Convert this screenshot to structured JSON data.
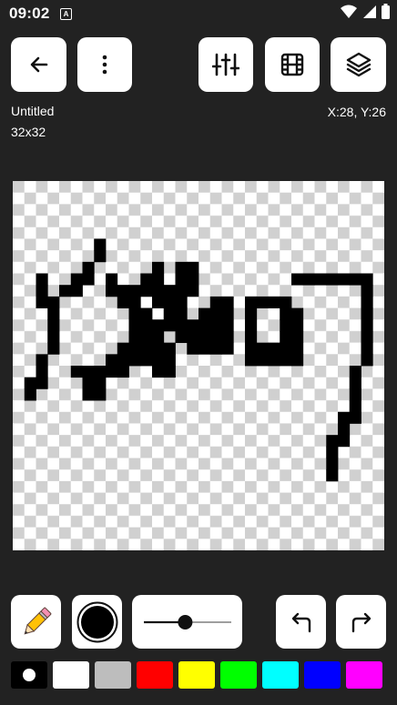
{
  "status_bar": {
    "time": "09:02",
    "app_indicator": "A",
    "icons": [
      "wifi-icon",
      "signal-icon",
      "battery-icon"
    ]
  },
  "toolbar": {
    "back_icon": "arrow-left-icon",
    "menu_icon": "more-vertical-icon",
    "adjust_icon": "sliders-icon",
    "frames_icon": "film-icon",
    "layers_icon": "layers-icon"
  },
  "document": {
    "name": "Untitled",
    "size": "32x32",
    "cursor": "X:28, Y:26"
  },
  "canvas": {
    "grid_cols": 32,
    "grid_rows": 32,
    "pixel_color": "#000000",
    "pixels": [
      [
        7,
        5
      ],
      [
        7,
        6
      ],
      [
        6,
        7
      ],
      [
        12,
        7
      ],
      [
        5,
        8
      ],
      [
        6,
        8
      ],
      [
        11,
        8
      ],
      [
        12,
        8
      ],
      [
        2,
        8
      ],
      [
        2,
        9
      ],
      [
        2,
        10
      ],
      [
        4,
        9
      ],
      [
        5,
        9
      ],
      [
        3,
        10
      ],
      [
        8,
        8
      ],
      [
        8,
        9
      ],
      [
        9,
        9
      ],
      [
        9,
        10
      ],
      [
        10,
        10
      ],
      [
        10,
        9
      ],
      [
        11,
        9
      ],
      [
        24,
        8
      ],
      [
        25,
        8
      ],
      [
        26,
        8
      ],
      [
        27,
        8
      ],
      [
        28,
        8
      ],
      [
        29,
        8
      ],
      [
        30,
        8
      ],
      [
        30,
        9
      ],
      [
        30,
        10
      ],
      [
        30,
        11
      ],
      [
        30,
        12
      ],
      [
        30,
        13
      ],
      [
        30,
        14
      ],
      [
        30,
        15
      ],
      [
        20,
        10
      ],
      [
        21,
        10
      ],
      [
        22,
        10
      ],
      [
        23,
        10
      ],
      [
        20,
        11
      ],
      [
        23,
        11
      ],
      [
        20,
        12
      ],
      [
        23,
        12
      ],
      [
        20,
        13
      ],
      [
        23,
        13
      ],
      [
        20,
        14
      ],
      [
        21,
        14
      ],
      [
        22,
        14
      ],
      [
        23,
        14
      ],
      [
        24,
        14
      ],
      [
        24,
        13
      ],
      [
        24,
        12
      ],
      [
        24,
        11
      ],
      [
        20,
        15
      ],
      [
        21,
        15
      ],
      [
        22,
        15
      ],
      [
        23,
        15
      ],
      [
        24,
        15
      ],
      [
        17,
        10
      ],
      [
        18,
        10
      ],
      [
        18,
        11
      ],
      [
        16,
        11
      ],
      [
        17,
        11
      ],
      [
        18,
        12
      ],
      [
        14,
        12
      ],
      [
        15,
        12
      ],
      [
        16,
        12
      ],
      [
        17,
        12
      ],
      [
        14,
        13
      ],
      [
        15,
        13
      ],
      [
        16,
        13
      ],
      [
        17,
        13
      ],
      [
        10,
        11
      ],
      [
        10,
        12
      ],
      [
        11,
        11
      ],
      [
        11,
        12
      ],
      [
        11,
        13
      ],
      [
        11,
        14
      ],
      [
        10,
        13
      ],
      [
        12,
        13
      ],
      [
        12,
        14
      ],
      [
        12,
        15
      ],
      [
        13,
        14
      ],
      [
        13,
        15
      ],
      [
        13,
        16
      ],
      [
        12,
        16
      ],
      [
        3,
        11
      ],
      [
        3,
        12
      ],
      [
        3,
        13
      ],
      [
        3,
        14
      ],
      [
        2,
        15
      ],
      [
        2,
        16
      ],
      [
        1,
        17
      ],
      [
        1,
        18
      ],
      [
        2,
        17
      ],
      [
        8,
        15
      ],
      [
        9,
        15
      ],
      [
        8,
        16
      ],
      [
        9,
        16
      ],
      [
        7,
        16
      ],
      [
        7,
        17
      ],
      [
        6,
        17
      ],
      [
        6,
        16
      ],
      [
        5,
        16
      ],
      [
        6,
        18
      ],
      [
        7,
        18
      ],
      [
        9,
        14
      ],
      [
        10,
        14
      ],
      [
        10,
        15
      ],
      [
        11,
        15
      ],
      [
        29,
        16
      ],
      [
        29,
        17
      ],
      [
        29,
        18
      ],
      [
        29,
        19
      ],
      [
        28,
        20
      ],
      [
        29,
        20
      ],
      [
        28,
        21
      ],
      [
        27,
        22
      ],
      [
        28,
        22
      ],
      [
        27,
        23
      ],
      [
        27,
        24
      ],
      [
        27,
        25
      ],
      [
        12,
        9
      ],
      [
        13,
        9
      ],
      [
        13,
        10
      ],
      [
        13,
        11
      ],
      [
        12,
        10
      ],
      [
        12,
        12
      ],
      [
        13,
        12
      ],
      [
        14,
        8
      ],
      [
        14,
        9
      ],
      [
        14,
        10
      ],
      [
        14,
        11
      ],
      [
        15,
        7
      ],
      [
        15,
        8
      ],
      [
        15,
        9
      ],
      [
        14,
        7
      ],
      [
        16,
        13
      ],
      [
        16,
        14
      ],
      [
        17,
        14
      ],
      [
        18,
        14
      ],
      [
        18,
        13
      ],
      [
        15,
        14
      ]
    ]
  },
  "tools": {
    "pencil_icon": "pencil-icon",
    "color_icon": "color-circle-icon",
    "brush_size": 0.4,
    "undo_icon": "undo-icon",
    "redo_icon": "redo-icon"
  },
  "palette": {
    "colors": [
      "#000000",
      "#ffffff",
      "#bdbdbd",
      "#ff0000",
      "#ffff00",
      "#00ff00",
      "#00ffff",
      "#0000ff",
      "#ff00ff"
    ],
    "selected_index": 0
  }
}
